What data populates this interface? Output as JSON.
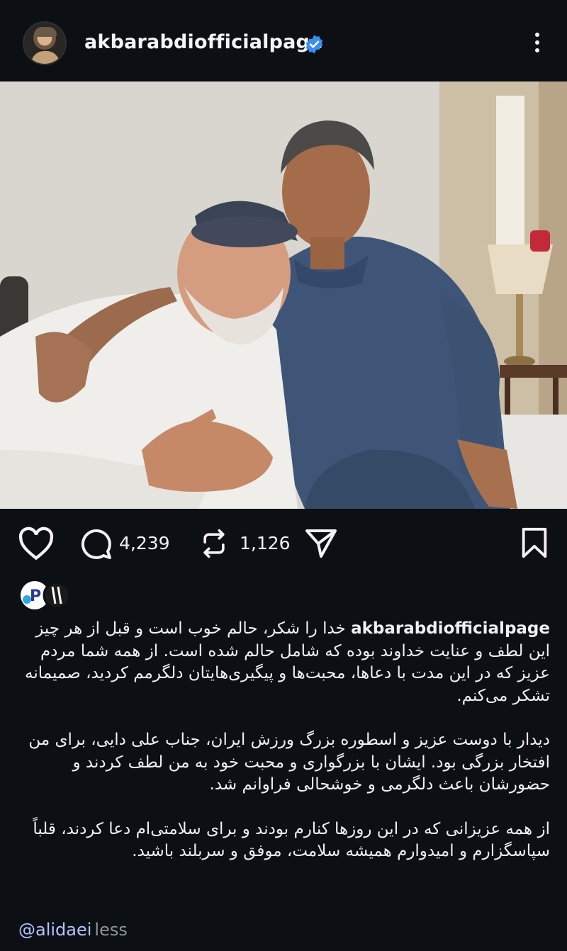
{
  "post": {
    "username": "akbarabdiofficialpage",
    "verified_icon": "verified-badge-icon",
    "more_icon": "more-options-icon"
  },
  "actions": {
    "comments_count": "4,239",
    "reposts_count": "1,126"
  },
  "caption": {
    "username": "akbarabdiofficialpage",
    "paragraph_1": "خدا را شکر، حالم خوب است و قبل از هر چیز این لطف و عنایت خداوند بوده که شامل حالم شده است. از همه شما مردم عزیز که در این مدت با دعاها، محبت‌ها و پیگیری‌هایتان دلگرمم کردید، صمیمانه تشکر می‌کنم.",
    "paragraph_2": "دیدار با دوست عزیز و اسطوره بزرگ ورزش ایران، جناب علی دایی، برای من افتخار بزرگی بود. ایشان با بزرگواری و محبت خود به من لطف کردند و حضورشان باعث دلگرمی و خوشحالی فراوانم شد.",
    "paragraph_3": "از همه عزیزانی که در این روزها کنارم بودند و برای سلامتی‌ام دعا کردند، قلباً سپاسگزارم و امیدوارم همیشه سلامت، موفق و سربلند باشید.",
    "mention": "@alidaei",
    "less_label": "less"
  }
}
